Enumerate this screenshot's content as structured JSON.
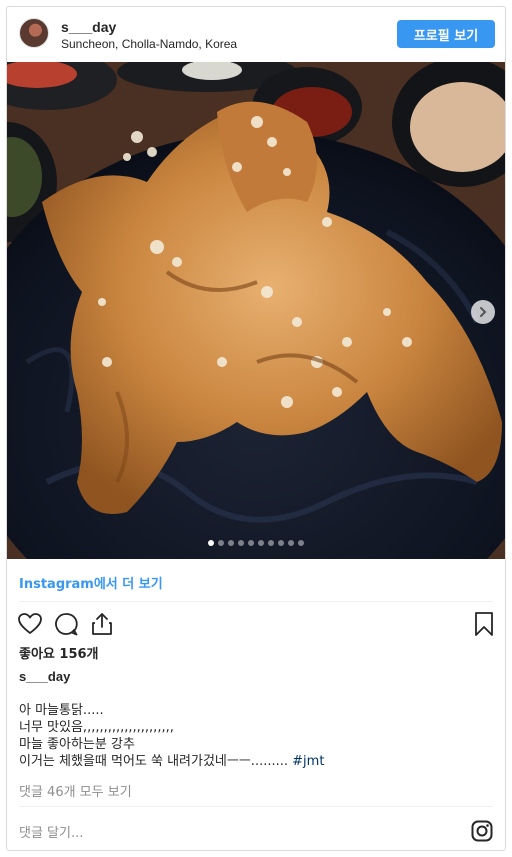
{
  "header": {
    "username": "s___day",
    "location": "Suncheon, Cholla-Namdo, Korea",
    "profile_button": "프로필 보기"
  },
  "carousel": {
    "slide_count": 10,
    "active_index": 0
  },
  "view_more": "Instagram에서 더 보기",
  "actions": {
    "icons": [
      "heart-icon",
      "comment-icon",
      "share-icon",
      "bookmark-icon"
    ]
  },
  "likes": "좋아요 156개",
  "caption": {
    "username": "s___day",
    "lines": [
      "아 마늘통닭.....",
      "너무 맛있음,,,,,,,,,,,,,,,,,,,,,,",
      "마늘 좋아하는분 강추",
      "이거는 체했을때 먹어도 쑥 내려가겄네ㅡㅡ........."
    ],
    "hashtag": "#jmt"
  },
  "comments_link": "댓글 46개 모두 보기",
  "comment_placeholder": "댓글 달기...",
  "colors": {
    "accent": "#3897f0",
    "border": "#dbdbdb",
    "muted": "#8e8e8e"
  }
}
